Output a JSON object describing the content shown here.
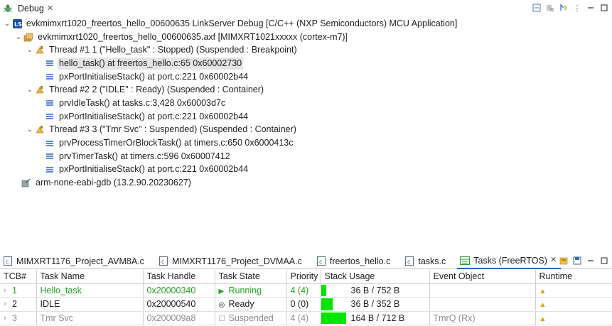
{
  "debug_view": {
    "tab_label": "Debug",
    "tree": [
      {
        "level": 0,
        "twisty": "open",
        "icon": "ls-launch-icon",
        "text": "evkmimxrt1020_freertos_hello_00600635 LinkServer Debug [C/C++ (NXP Semiconductors) MCU Application]"
      },
      {
        "level": 1,
        "twisty": "open",
        "icon": "debug-target-icon",
        "text": "evkmimxrt1020_freertos_hello_00600635.axf [MIMXRT1021xxxxx (cortex-m7)]"
      },
      {
        "level": 2,
        "twisty": "open",
        "icon": "thread-icon",
        "text": "Thread #1 1 (\"Hello_task\" : Stopped) (Suspended : Breakpoint)"
      },
      {
        "level": 3,
        "icon": "stack-frame-icon",
        "text": "hello_task() at freertos_hello.c:65 0x60002730",
        "selected": true
      },
      {
        "level": 3,
        "icon": "stack-frame-icon",
        "text": "pxPortInitialiseStack() at port.c:221 0x60002b44"
      },
      {
        "level": 2,
        "twisty": "open",
        "icon": "thread-icon",
        "text": "Thread #2 2 (\"IDLE\" : Ready) (Suspended : Container)"
      },
      {
        "level": 3,
        "icon": "stack-frame-icon",
        "text": "prvIdleTask() at tasks.c:3,428 0x60003d7c"
      },
      {
        "level": 3,
        "icon": "stack-frame-icon",
        "text": "pxPortInitialiseStack() at port.c:221 0x60002b44"
      },
      {
        "level": 2,
        "twisty": "open",
        "icon": "thread-icon",
        "text": "Thread #3 3 (\"Tmr Svc\" : Suspended) (Suspended : Container)"
      },
      {
        "level": 3,
        "icon": "stack-frame-icon",
        "text": "prvProcessTimerOrBlockTask() at timers.c:650 0x6000413c"
      },
      {
        "level": 3,
        "icon": "stack-frame-icon",
        "text": "prvTimerTask() at timers.c:596 0x60007412"
      },
      {
        "level": 3,
        "icon": "stack-frame-icon",
        "text": "pxPortInitialiseStack() at port.c:221 0x60002b44"
      },
      {
        "level": "gdb",
        "icon": "gdb-process-icon",
        "text": "arm-none-eabi-gdb (13.2.90.20230627)"
      }
    ]
  },
  "bottom_tabs": [
    {
      "label": "MIMXRT1176_Project_AVM8A.c",
      "icon": "c-file-icon",
      "active": false
    },
    {
      "label": "MIMXRT1176_Project_DVMAA.c",
      "icon": "c-file-icon",
      "active": false
    },
    {
      "label": "freertos_hello.c",
      "icon": "c-file-icon",
      "active": false
    },
    {
      "label": "tasks.c",
      "icon": "c-file-icon",
      "active": false
    },
    {
      "label": "Tasks (FreeRTOS)",
      "icon": "tasks-view-icon",
      "active": true,
      "closable": true
    }
  ],
  "tasks_table": {
    "columns": [
      "TCB#",
      "Task Name",
      "Task Handle",
      "Task State",
      "Priority",
      "Stack Usage",
      "Event Object",
      "Runtime"
    ],
    "rows": [
      {
        "tcb": "1",
        "name": "Hello_task",
        "handle": "0x20000340",
        "state": "Running",
        "state_icon": "▶",
        "priority": "4 (4)",
        "stack": "36 B / 752 B",
        "stack_fraction": 0.048,
        "event": "",
        "runtime_icon": "runtime-icon",
        "style": "running"
      },
      {
        "tcb": "2",
        "name": "IDLE",
        "handle": "0x20000540",
        "state": "Ready",
        "state_icon": "◎",
        "priority": "0 (0)",
        "stack": "36 B / 352 B",
        "stack_fraction": 0.102,
        "event": "",
        "runtime_icon": "runtime-icon",
        "style": "ready"
      },
      {
        "tcb": "3",
        "name": "Tmr Svc",
        "handle": "0x200009a8",
        "state": "Suspended",
        "state_icon": "☐",
        "priority": "4 (4)",
        "stack": "164 B / 712 B",
        "stack_fraction": 0.23,
        "event": "TmrQ (Rx)",
        "runtime_icon": "runtime-icon",
        "style": "suspended"
      }
    ]
  },
  "colors": {
    "running": "#28a428",
    "suspended": "#8c8c8c",
    "stack_bar": "#00e600",
    "selection": "#e4e4e4",
    "accent": "#0a64c8"
  }
}
